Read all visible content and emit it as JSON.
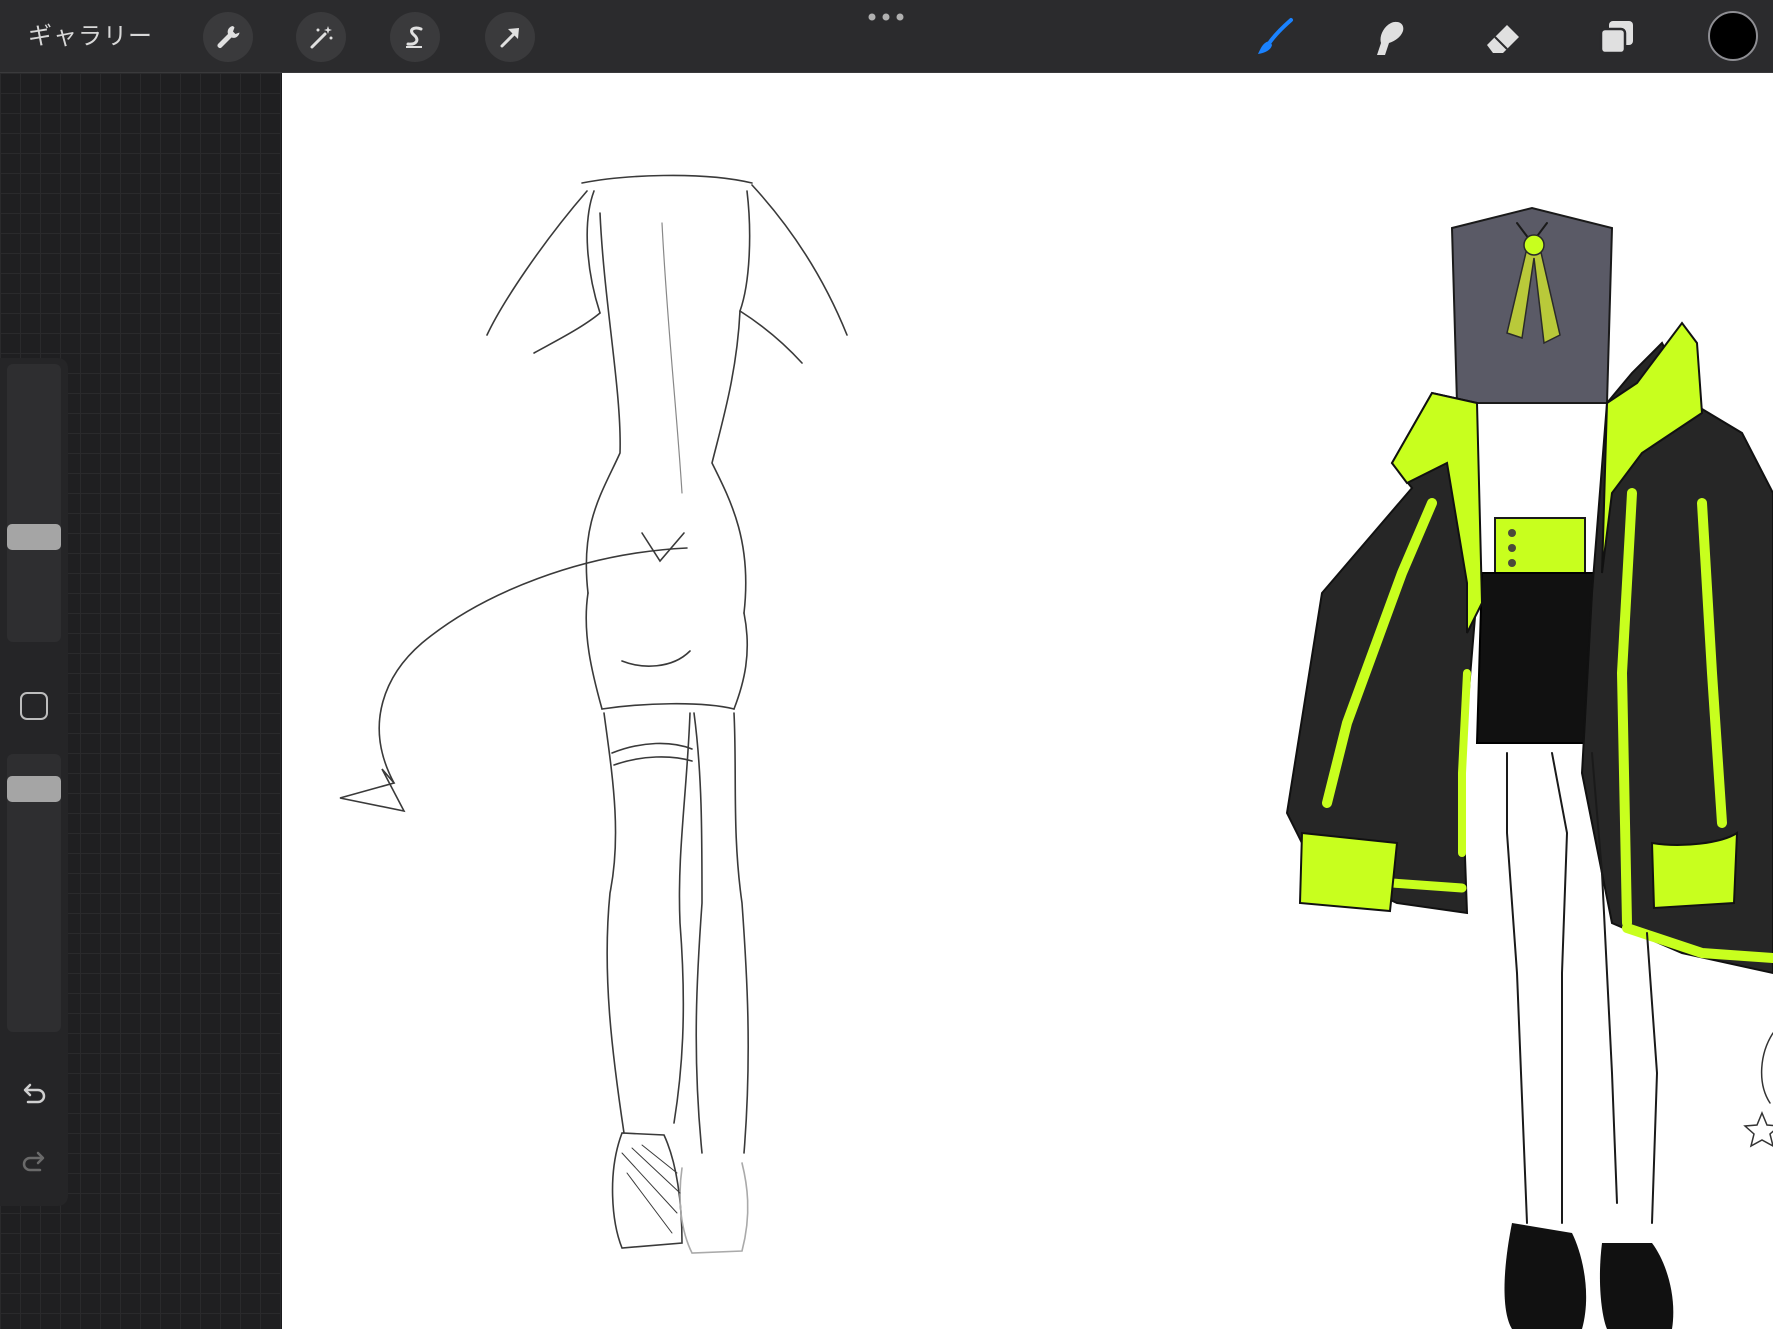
{
  "toolbar": {
    "gallery_label": "ギャラリー",
    "left_tools": [
      "wrench-icon",
      "magic-wand-icon",
      "selection-s-icon",
      "transform-arrow-icon"
    ],
    "right_tools": [
      "brush-icon",
      "smudge-icon",
      "eraser-icon",
      "layers-icon"
    ],
    "active_tool": "brush-icon",
    "accent_color": "#1a82ff",
    "current_color": "#000000"
  },
  "sidebar": {
    "brush_size_level": 0.6,
    "opacity_level": 0.15,
    "icons": [
      "modify-square-icon",
      "undo-icon",
      "redo-icon"
    ]
  },
  "canvas": {
    "background": "#ffffff",
    "colors": {
      "lime": "#c8ff1e",
      "jacket": "#262626",
      "shirt": "#5a5a66"
    }
  }
}
